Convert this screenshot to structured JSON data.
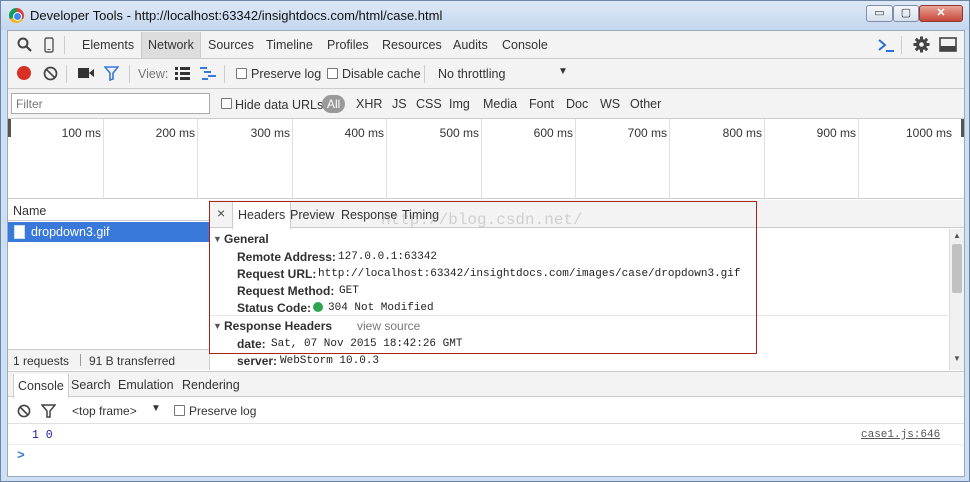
{
  "window": {
    "title": "Developer Tools - http://localhost:63342/insightdocs.com/html/case.html",
    "buttons": {
      "minimize": "▭",
      "maximize": "▢",
      "close": "✕"
    }
  },
  "devtools": {
    "tabs": [
      "Elements",
      "Network",
      "Sources",
      "Timeline",
      "Profiles",
      "Resources",
      "Audits",
      "Console"
    ],
    "active_tab": "Network"
  },
  "network_toolbar": {
    "view_label": "View:",
    "preserve_log": "Preserve log",
    "disable_cache": "Disable cache",
    "throttling": "No throttling"
  },
  "filter_bar": {
    "placeholder": "Filter",
    "hide_data_urls": "Hide data URLs",
    "types": [
      "All",
      "XHR",
      "JS",
      "CSS",
      "Img",
      "Media",
      "Font",
      "Doc",
      "WS",
      "Other"
    ]
  },
  "timeline": {
    "ticks": [
      "100 ms",
      "200 ms",
      "300 ms",
      "400 ms",
      "500 ms",
      "600 ms",
      "700 ms",
      "800 ms",
      "900 ms",
      "1000 ms"
    ]
  },
  "request_list": {
    "column_name": "Name",
    "selected_file": "dropdown3.gif",
    "summary_requests": "1 requests",
    "summary_transferred": "91 B transferred"
  },
  "detail": {
    "close": "×",
    "tabs": [
      "Headers",
      "Preview",
      "Response",
      "Timing"
    ],
    "active_tab": "Headers",
    "general_title": "General",
    "remote_address_label": "Remote Address:",
    "remote_address": "127.0.0.1:63342",
    "request_url_label": "Request URL:",
    "request_url": "http://localhost:63342/insightdocs.com/images/case/dropdown3.gif",
    "request_method_label": "Request Method:",
    "request_method": "GET",
    "status_code_label": "Status Code:",
    "status_code": "304 Not Modified",
    "status_color": "#2ea44f",
    "response_headers_title": "Response Headers",
    "view_source": "view source",
    "date_label": "date:",
    "date_value": "Sat, 07 Nov 2015 18:42:26 GMT",
    "server_label": "server:",
    "server_value": "WebStorm 10.0.3"
  },
  "watermark": "http://blog.csdn.net/",
  "drawer": {
    "tabs": [
      "Console",
      "Search",
      "Emulation",
      "Rendering"
    ],
    "active_tab": "Console",
    "frame": "<top frame>",
    "preserve_log": "Preserve log",
    "log_message": "1 0",
    "log_source": "case1.js:646",
    "prompt": ">"
  },
  "colors": {
    "accent_blue": "#3879d9",
    "record_red": "#d93025",
    "highlight_box": "#a8231a"
  }
}
